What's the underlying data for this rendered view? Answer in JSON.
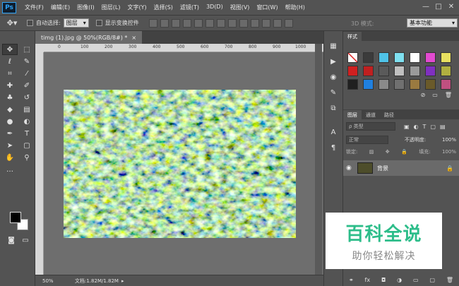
{
  "app": {
    "logo": "Ps"
  },
  "menu": [
    "文件(F)",
    "编辑(E)",
    "图像(I)",
    "图层(L)",
    "文字(Y)",
    "选择(S)",
    "滤镜(T)",
    "3D(D)",
    "视图(V)",
    "窗口(W)",
    "帮助(H)"
  ],
  "window_controls": {
    "minimize": "—",
    "maximize": "□",
    "close": "✕"
  },
  "options": {
    "auto_select_label": "自动选择:",
    "auto_select_value": "图层",
    "show_transform_label": "显示变换控件",
    "mode_3d_label": "3D 模式:",
    "workspace": "基本功能"
  },
  "document": {
    "tab_title": "timg (1).jpg @ 50%(RGB/8#) *",
    "ruler_ticks": [
      "0",
      "100",
      "200",
      "300",
      "400",
      "500",
      "600",
      "700",
      "800",
      "900",
      "1000"
    ],
    "zoom": "50%",
    "doc_info": "文档:1.82M/1.82M"
  },
  "panels": {
    "styles_tab": "样式",
    "layers_tabs": [
      "图层",
      "通道",
      "路径"
    ],
    "filter_kind": "ρ 类型",
    "blend_mode": "正常",
    "opacity_label": "不透明度:",
    "opacity_value": "100%",
    "lock_label": "锁定:",
    "fill_label": "填充:",
    "fill_value": "100%",
    "layer_name": "背景"
  },
  "watermark": {
    "title": "百科全说",
    "subtitle": "助你轻松解决"
  },
  "colors": {
    "accent": "#2fa3f7",
    "watermark_green": "#2dbd8a",
    "style_swatches": [
      "#ffffff",
      "#3b3b3b",
      "#4fc3e8",
      "#7fe0f0",
      "#ffffff",
      "#e24ad0",
      "#e8e060",
      "#d02020",
      "#c02020",
      "#5a5a5a",
      "#c0c0c0",
      "#9a9a9a",
      "#8030c0",
      "#b0b040",
      "#202020",
      "#2080e0",
      "#8a8a8a",
      "#707070",
      "#9a7a40",
      "#6a5a2a",
      "#c05080"
    ]
  }
}
